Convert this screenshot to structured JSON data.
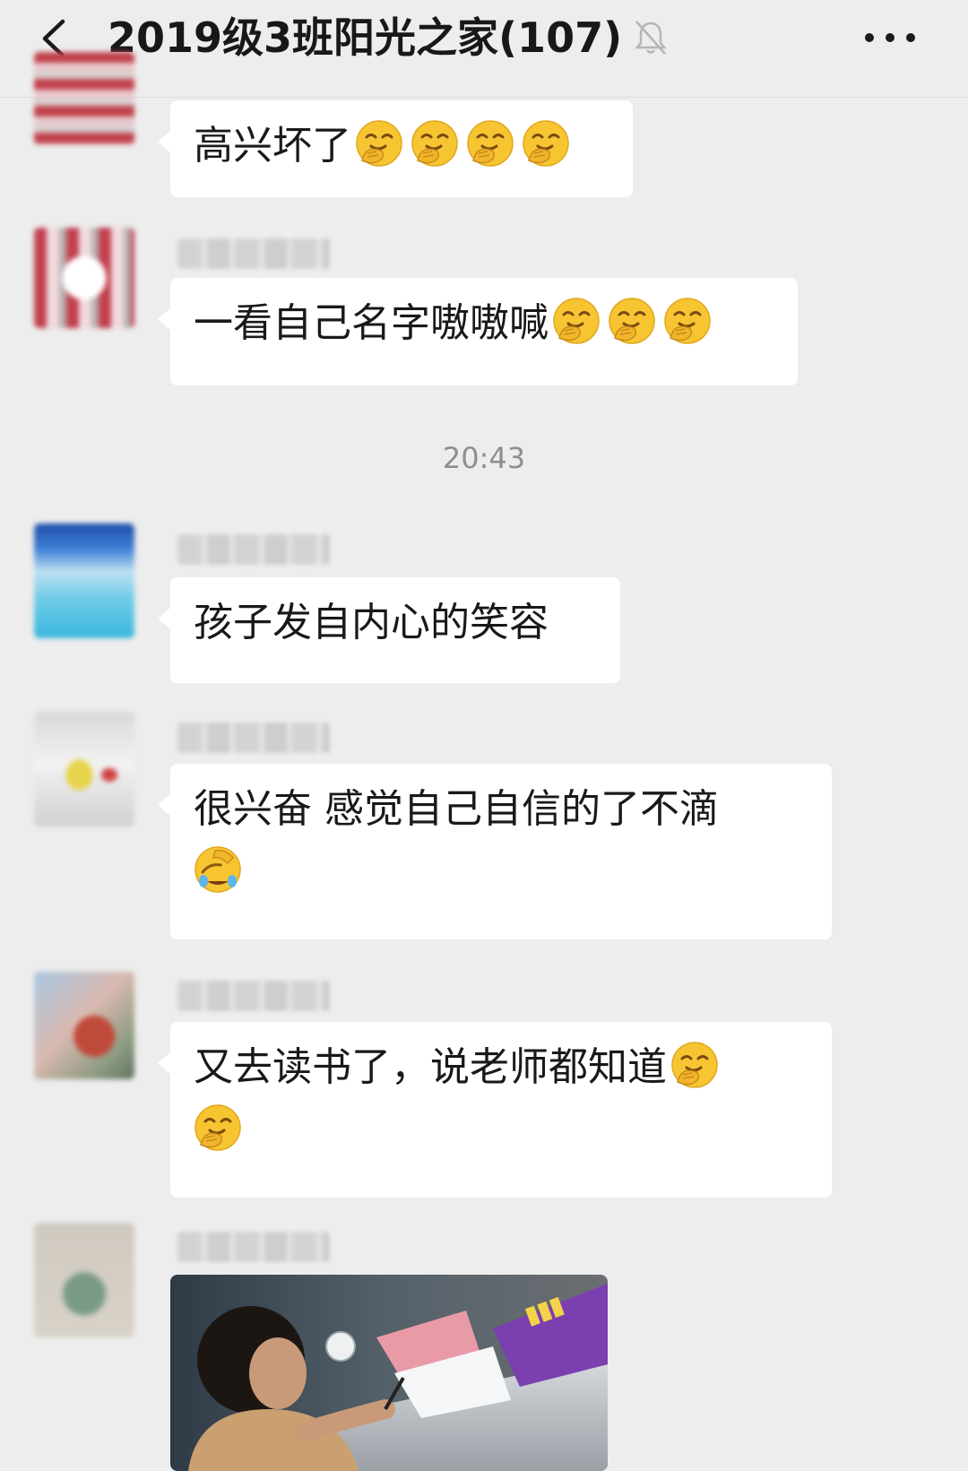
{
  "header": {
    "title": "2019级3班阳光之家(107)",
    "back_icon": "chevron-left-icon",
    "mute_icon": "bell-off-icon",
    "more_icon": "more-horizontal-icon"
  },
  "messages": [
    {
      "text": "高兴坏了",
      "emoji_count": 4,
      "emoji": "covering-mouth-laugh"
    },
    {
      "text": "一看自己名字嗷嗷喊",
      "emoji_count": 3,
      "emoji": "covering-mouth-laugh"
    },
    {
      "text": "孩子发自内心的笑容"
    },
    {
      "text_line1": "很兴奋  感觉自己自信的了不滴",
      "emoji": "facepalm-tears"
    },
    {
      "text_line1": "又去读书了，说老师都知道",
      "emoji": "covering-mouth-laugh"
    }
  ],
  "timestamp": "20:43",
  "photo": {
    "description_icon": "photo-child-reading"
  },
  "colors": {
    "background": "#ededed",
    "bubble": "#ffffff",
    "text": "#191919",
    "timestamp": "#8e8e8e"
  }
}
